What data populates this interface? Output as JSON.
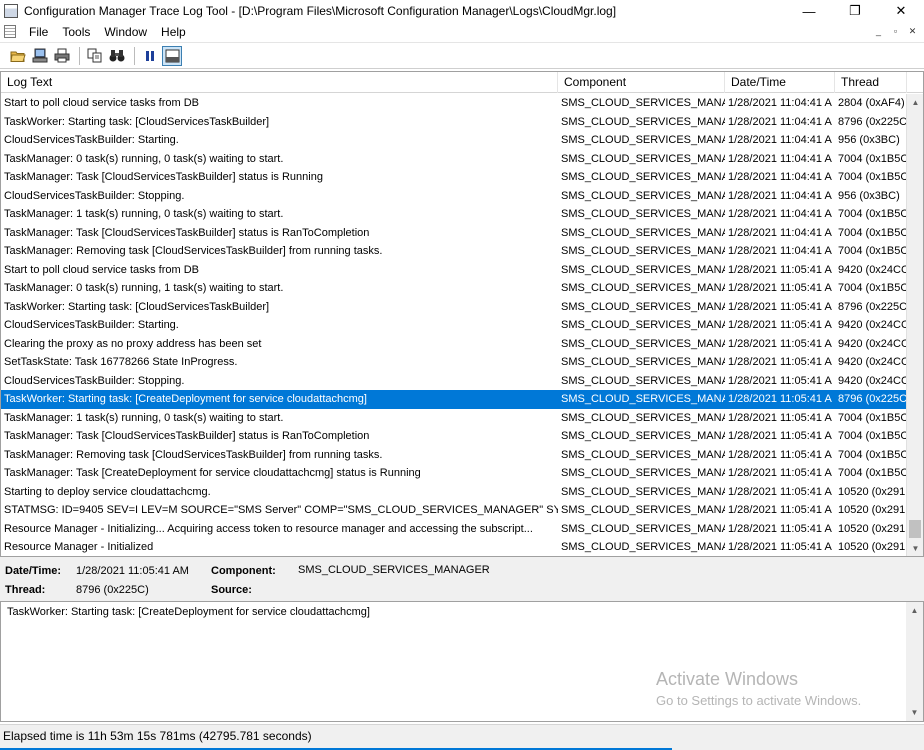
{
  "window": {
    "title": "Configuration Manager Trace Log Tool - [D:\\Program Files\\Microsoft Configuration Manager\\Logs\\CloudMgr.log]",
    "minimize": "—",
    "restore": "❐",
    "close": "✕"
  },
  "menu": {
    "items": [
      "File",
      "Tools",
      "Window",
      "Help"
    ],
    "mdi": [
      "_",
      "▫",
      "✕"
    ]
  },
  "toolbar": {
    "open_icon": "open-folder-icon",
    "print_icon": "print-icon",
    "copy_icon": "copy-icon",
    "find_icon": "find-binoculars-icon",
    "pause_icon": "pause-icon",
    "details_icon": "details-pane-icon"
  },
  "grid": {
    "columns": [
      "Log Text",
      "Component",
      "Date/Time",
      "Thread"
    ],
    "rows": [
      {
        "text": "Start to poll cloud service tasks from DB",
        "component": "SMS_CLOUD_SERVICES_MANAG",
        "datetime": "1/28/2021 11:04:41 A",
        "thread": "2804 (0xAF4)"
      },
      {
        "text": "TaskWorker: Starting task: [CloudServicesTaskBuilder]",
        "component": "SMS_CLOUD_SERVICES_MANAG",
        "datetime": "1/28/2021 11:04:41 A",
        "thread": "8796 (0x225C"
      },
      {
        "text": "CloudServicesTaskBuilder: Starting.",
        "component": "SMS_CLOUD_SERVICES_MANAG",
        "datetime": "1/28/2021 11:04:41 A",
        "thread": "956 (0x3BC)"
      },
      {
        "text": "TaskManager: 0 task(s) running, 0 task(s) waiting to start.",
        "component": "SMS_CLOUD_SERVICES_MANAG",
        "datetime": "1/28/2021 11:04:41 A",
        "thread": "7004 (0x1B5C"
      },
      {
        "text": "TaskManager: Task [CloudServicesTaskBuilder] status is Running",
        "component": "SMS_CLOUD_SERVICES_MANAG",
        "datetime": "1/28/2021 11:04:41 A",
        "thread": "7004 (0x1B5C"
      },
      {
        "text": "CloudServicesTaskBuilder: Stopping.",
        "component": "SMS_CLOUD_SERVICES_MANAG",
        "datetime": "1/28/2021 11:04:41 A",
        "thread": "956 (0x3BC)"
      },
      {
        "text": "TaskManager: 1 task(s) running, 0 task(s) waiting to start.",
        "component": "SMS_CLOUD_SERVICES_MANAG",
        "datetime": "1/28/2021 11:04:41 A",
        "thread": "7004 (0x1B5C"
      },
      {
        "text": "TaskManager: Task [CloudServicesTaskBuilder] status is RanToCompletion",
        "component": "SMS_CLOUD_SERVICES_MANAG",
        "datetime": "1/28/2021 11:04:41 A",
        "thread": "7004 (0x1B5C"
      },
      {
        "text": "TaskManager: Removing task [CloudServicesTaskBuilder] from running tasks.",
        "component": "SMS_CLOUD_SERVICES_MANAG",
        "datetime": "1/28/2021 11:04:41 A",
        "thread": "7004 (0x1B5C"
      },
      {
        "text": "Start to poll cloud service tasks from DB",
        "component": "SMS_CLOUD_SERVICES_MANAG",
        "datetime": "1/28/2021 11:05:41 A",
        "thread": "9420 (0x24CC"
      },
      {
        "text": "TaskManager: 0 task(s) running, 1 task(s) waiting to start.",
        "component": "SMS_CLOUD_SERVICES_MANAG",
        "datetime": "1/28/2021 11:05:41 A",
        "thread": "7004 (0x1B5C"
      },
      {
        "text": "TaskWorker: Starting task: [CloudServicesTaskBuilder]",
        "component": "SMS_CLOUD_SERVICES_MANAG",
        "datetime": "1/28/2021 11:05:41 A",
        "thread": "8796 (0x225C"
      },
      {
        "text": "CloudServicesTaskBuilder: Starting.",
        "component": "SMS_CLOUD_SERVICES_MANAG",
        "datetime": "1/28/2021 11:05:41 A",
        "thread": "9420 (0x24CC"
      },
      {
        "text": "Clearing the proxy as no proxy address has been set",
        "component": "SMS_CLOUD_SERVICES_MANAG",
        "datetime": "1/28/2021 11:05:41 A",
        "thread": "9420 (0x24CC"
      },
      {
        "text": "SetTaskState: Task 16778266 State InProgress.",
        "component": "SMS_CLOUD_SERVICES_MANAG",
        "datetime": "1/28/2021 11:05:41 A",
        "thread": "9420 (0x24CC"
      },
      {
        "text": "CloudServicesTaskBuilder: Stopping.",
        "component": "SMS_CLOUD_SERVICES_MANAG",
        "datetime": "1/28/2021 11:05:41 A",
        "thread": "9420 (0x24CC"
      },
      {
        "text": "TaskWorker: Starting task: [CreateDeployment for service cloudattachcmg]",
        "component": "SMS_CLOUD_SERVICES_MANAG",
        "datetime": "1/28/2021 11:05:41 A",
        "thread": "8796 (0x225C",
        "selected": true
      },
      {
        "text": "TaskManager: 1 task(s) running, 0 task(s) waiting to start.",
        "component": "SMS_CLOUD_SERVICES_MANAG",
        "datetime": "1/28/2021 11:05:41 A",
        "thread": "7004 (0x1B5C"
      },
      {
        "text": "TaskManager: Task [CloudServicesTaskBuilder] status is RanToCompletion",
        "component": "SMS_CLOUD_SERVICES_MANAG",
        "datetime": "1/28/2021 11:05:41 A",
        "thread": "7004 (0x1B5C"
      },
      {
        "text": "TaskManager: Removing task [CloudServicesTaskBuilder] from running tasks.",
        "component": "SMS_CLOUD_SERVICES_MANAG",
        "datetime": "1/28/2021 11:05:41 A",
        "thread": "7004 (0x1B5C"
      },
      {
        "text": "TaskManager: Task [CreateDeployment for service cloudattachcmg] status is Running",
        "component": "SMS_CLOUD_SERVICES_MANAG",
        "datetime": "1/28/2021 11:05:41 A",
        "thread": "7004 (0x1B5C"
      },
      {
        "text": "Starting to deploy service cloudattachcmg.",
        "component": "SMS_CLOUD_SERVICES_MANAG",
        "datetime": "1/28/2021 11:05:41 A",
        "thread": "10520 (0x291"
      },
      {
        "text": "STATMSG: ID=9405 SEV=I LEV=M SOURCE=\"SMS Server\" COMP=\"SMS_CLOUD_SERVICES_MANAGER\" SYS...",
        "component": "SMS_CLOUD_SERVICES_MANAG",
        "datetime": "1/28/2021 11:05:41 A",
        "thread": "10520 (0x291"
      },
      {
        "text": "Resource Manager - Initializing... Acquiring access token to resource manager and accessing the subscript...",
        "component": "SMS_CLOUD_SERVICES_MANAG",
        "datetime": "1/28/2021 11:05:41 A",
        "thread": "10520 (0x291"
      },
      {
        "text": "Resource Manager - Initialized",
        "component": "SMS_CLOUD_SERVICES_MANAG",
        "datetime": "1/28/2021 11:05:41 A",
        "thread": "10520 (0x291"
      }
    ]
  },
  "details": {
    "datetime_label": "Date/Time:",
    "datetime_value": "1/28/2021 11:05:41 AM",
    "component_label": "Component:",
    "component_value": "SMS_CLOUD_SERVICES_MANAGER",
    "thread_label": "Thread:",
    "thread_value": "8796 (0x225C)",
    "source_label": "Source:",
    "source_value": ""
  },
  "message": {
    "text": "TaskWorker: Starting task: [CreateDeployment for service cloudattachcmg]"
  },
  "watermark": {
    "line1": "Activate Windows",
    "line2": "Go to Settings to activate Windows."
  },
  "status": {
    "text": "Elapsed time is 11h 53m 15s 781ms (42795.781 seconds)"
  }
}
